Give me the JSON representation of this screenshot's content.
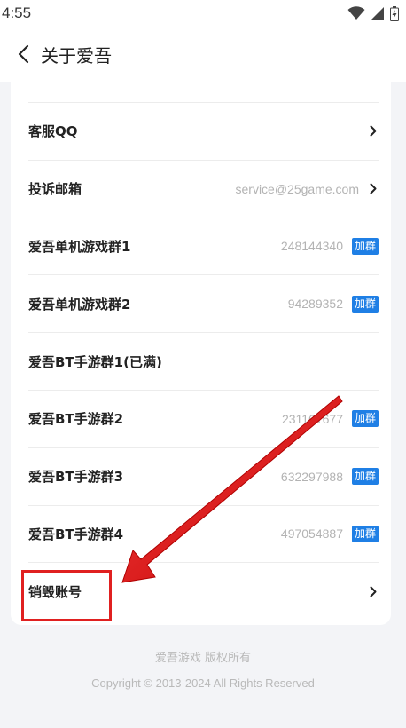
{
  "status_bar": {
    "time": "4:55",
    "icons": [
      "wifi-icon",
      "signal-icon",
      "battery-charging-icon"
    ]
  },
  "header": {
    "title": "关于爱吾",
    "back_icon": "chevron-left-icon"
  },
  "list": {
    "rows": [
      {
        "label": "客服QQ",
        "value": "",
        "action": "chevron-right-icon"
      },
      {
        "label": "投诉邮箱",
        "value": "service@25game.com",
        "action": "chevron-right-icon"
      },
      {
        "label": "爱吾单机游戏群1",
        "value": "248144340",
        "action": "加群"
      },
      {
        "label": "爱吾单机游戏群2",
        "value": "94289352",
        "action": "加群"
      },
      {
        "label": "爱吾BT手游群1(已满)",
        "value": "",
        "action": ""
      },
      {
        "label": "爱吾BT手游群2",
        "value": "231161677",
        "action": "加群"
      },
      {
        "label": "爱吾BT手游群3",
        "value": "632297988",
        "action": "加群"
      },
      {
        "label": "爱吾BT手游群4",
        "value": "497054887",
        "action": "加群"
      },
      {
        "label": "销毁账号",
        "value": "",
        "action": "chevron-right-icon"
      }
    ]
  },
  "footer": {
    "brand": "爱吾游戏 版权所有",
    "copyright": "Copyright © 2013-2024 All Rights Reserved"
  },
  "colors": {
    "accent": "#1f7fe5",
    "annotation": "#e02020",
    "background": "#f3f4f7"
  }
}
